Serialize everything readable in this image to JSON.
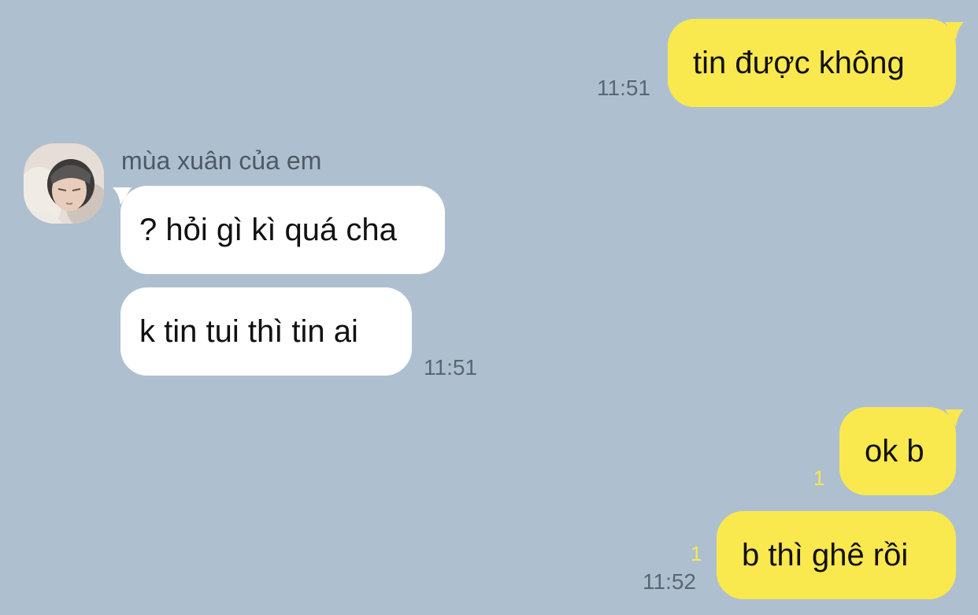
{
  "chat": {
    "contact_name": "mùa xuân của em",
    "messages": [
      {
        "from": "me",
        "text": "tin được không",
        "time": "11:51"
      },
      {
        "from": "them",
        "text": "? hỏi gì kì quá cha"
      },
      {
        "from": "them",
        "text": "k tin tui thì tin ai",
        "time": "11:51"
      },
      {
        "from": "me",
        "text": "ok b",
        "unread": "1"
      },
      {
        "from": "me",
        "text": "b thì ghê rồi",
        "unread": "1",
        "time": "11:52"
      }
    ]
  },
  "colors": {
    "background": "#aec0cf",
    "my_bubble": "#fae84f",
    "their_bubble": "#ffffff",
    "unread_count": "#fae84f"
  }
}
